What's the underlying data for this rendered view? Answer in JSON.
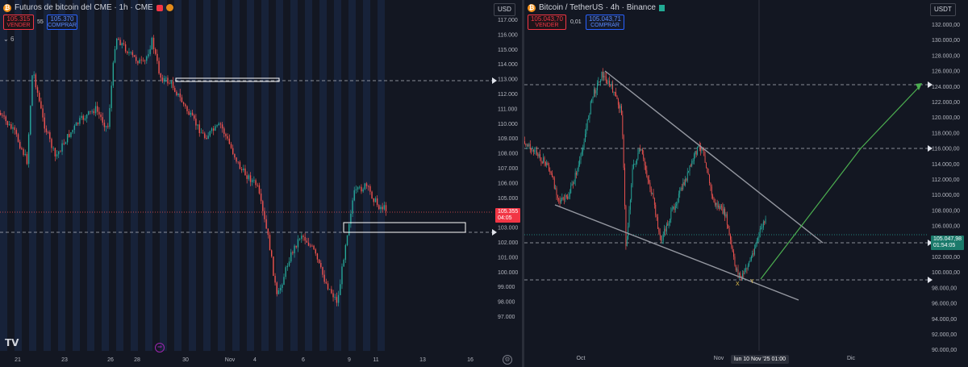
{
  "left": {
    "title": "Futuros de bitcoin del CME · 1h · CME",
    "sell_price": "105.315",
    "sell_label": "VENDER",
    "spread": "55",
    "buy_price": "105.370",
    "buy_label": "COMPRAR",
    "collapse_count": "6",
    "currency": "USD",
    "price_axis": [
      "117.000",
      "116.000",
      "115.000",
      "114.000",
      "113.000",
      "112.000",
      "111.000",
      "110.000",
      "109.000",
      "108.000",
      "107.000",
      "106.000",
      "105.000",
      "104.000",
      "103.000",
      "102.000",
      "101.000",
      "100.000",
      "99.000",
      "98.000",
      "97.000"
    ],
    "time_axis": [
      "21",
      "23",
      "26",
      "28",
      "30",
      "Nov",
      "4",
      "6",
      "9",
      "11",
      "13",
      "16"
    ],
    "current_price": "105.355",
    "countdown": "04:05"
  },
  "right": {
    "title": "Bitcoin / TetherUS · 4h · Binance",
    "sell_price": "105.043,70",
    "sell_label": "VENDER",
    "spread": "0,01",
    "buy_price": "105.043,71",
    "buy_label": "COMPRAR",
    "currency": "USDT",
    "price_axis": [
      "132.000,00",
      "130.000,00",
      "128.000,00",
      "126.000,00",
      "124.000,00",
      "122.000,00",
      "120.000,00",
      "118.000,00",
      "116.000,00",
      "114.000,00",
      "112.000,00",
      "110.000,00",
      "108.000,00",
      "106.000,00",
      "104.000,00",
      "102.000,00",
      "100.000,00",
      "98.000,00",
      "96.000,00",
      "94.000,00",
      "92.000,00",
      "90.000,00"
    ],
    "time_axis": [
      "Oct",
      "Nov",
      "Dic"
    ],
    "cursor_date": "lun 10 Nov '25   01:00",
    "current_price": "105.047,98",
    "countdown": "01:54:05",
    "markers": [
      "X",
      "Y"
    ]
  },
  "colors": {
    "background": "#131722",
    "bull": "#26a69a",
    "bear": "#ef5350",
    "grid_dash": "#b2b5be",
    "trend_gray": "#9598a1",
    "projection_green": "#4caf50",
    "session_band": "#1c2c4d"
  }
}
